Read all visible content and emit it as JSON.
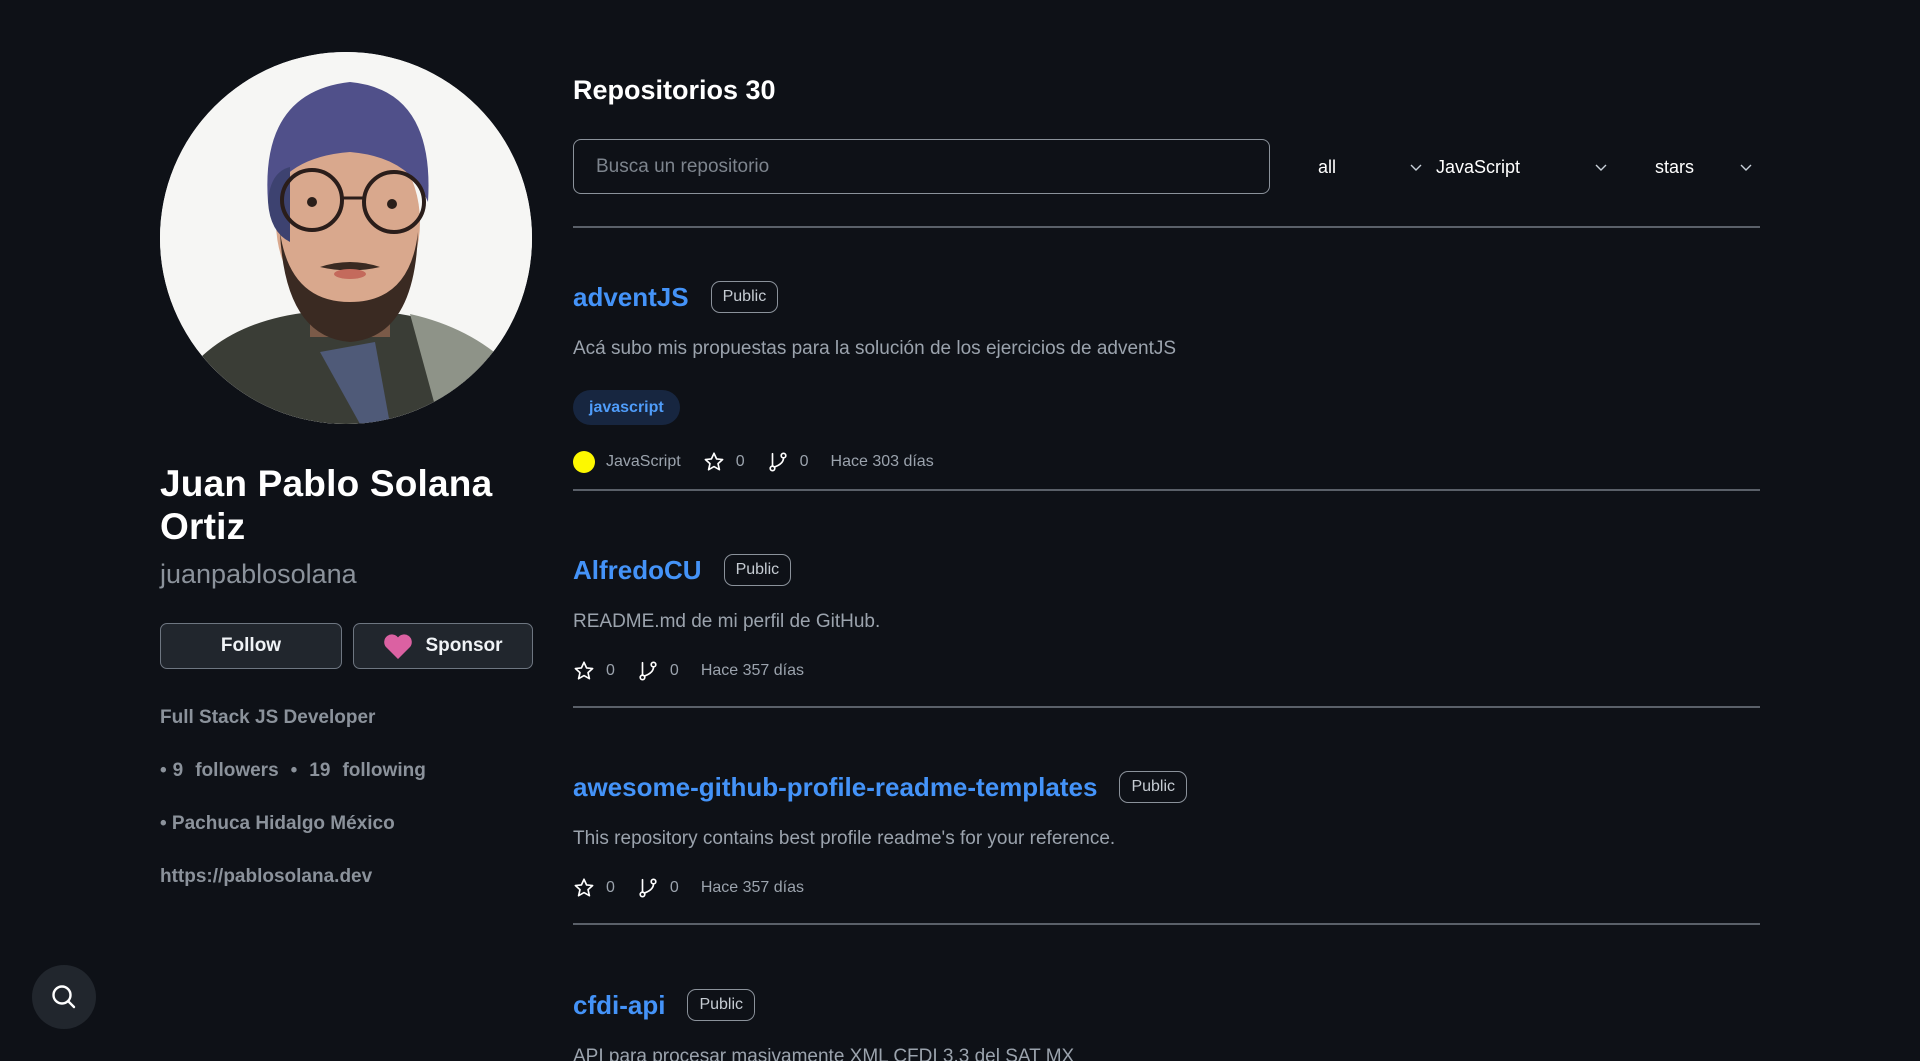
{
  "profile": {
    "full_name": "Juan Pablo Solana Ortiz",
    "username": "juanpablosolana",
    "follow_label": "Follow",
    "sponsor_label": "Sponsor",
    "bio": "Full Stack JS Developer",
    "followers_count": "9",
    "followers_label": "followers",
    "following_count": "19",
    "following_label": "following",
    "bullet": "•",
    "location": "• Pachuca Hidalgo México",
    "website": "https://pablosolana.dev"
  },
  "repos_header": {
    "title": "Repositorios 30",
    "search_placeholder": "Busca un repositorio",
    "search_value": "",
    "type_filter": "all",
    "language_filter": "JavaScript",
    "sort_filter": "stars"
  },
  "repos": [
    {
      "name": "adventJS",
      "visibility": "Public",
      "description": "Acá subo mis propuestas para la solución de los ejercicios de adventJS",
      "topics": [
        "javascript"
      ],
      "language": "JavaScript",
      "language_color": "#fdf800",
      "stars": "0",
      "forks": "0",
      "updated": "Hace 303 días"
    },
    {
      "name": "AlfredoCU",
      "visibility": "Public",
      "description": "README.md de mi perfil de GitHub.",
      "topics": [],
      "language": "",
      "stars": "0",
      "forks": "0",
      "updated": "Hace 357 días"
    },
    {
      "name": "awesome-github-profile-readme-templates",
      "visibility": "Public",
      "description": "This repository contains best profile readme's for your reference.",
      "topics": [],
      "language": "",
      "stars": "0",
      "forks": "0",
      "updated": "Hace 357 días"
    },
    {
      "name": "cfdi-api",
      "visibility": "Public",
      "description": "API para procesar masivamente XML CFDI 3.3 del SAT MX",
      "topics": [],
      "language": "",
      "stars": "",
      "forks": "",
      "updated": ""
    }
  ],
  "colors": {
    "background": "#0e1117",
    "link": "#4493f8",
    "heart": "#db61a2",
    "topic_bg": "#172640"
  },
  "icons": {
    "search_fab": "search-icon",
    "star": "star-icon",
    "fork": "fork-icon",
    "heart": "heart-icon",
    "chevron": "chevron-down-icon"
  }
}
